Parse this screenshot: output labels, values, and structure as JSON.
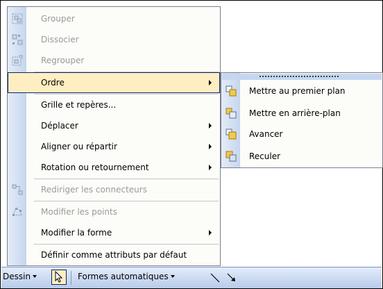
{
  "menu": {
    "items": [
      {
        "label": "Grouper",
        "disabled": true,
        "icon": "group-icon"
      },
      {
        "label": "Dissocier",
        "disabled": true,
        "icon": "ungroup-icon"
      },
      {
        "label": "Regrouper",
        "disabled": true,
        "icon": "regroup-icon"
      },
      {
        "label": "Ordre",
        "submenu": true,
        "highlighted": true
      },
      {
        "label": "Grille et repères...",
        "disabled": false
      },
      {
        "label": "Déplacer",
        "submenu": true
      },
      {
        "label": "Aligner ou répartir",
        "submenu": true
      },
      {
        "label": "Rotation ou retournement",
        "submenu": true
      },
      {
        "label": "Rediriger les connecteurs",
        "disabled": true,
        "icon": "reroute-connectors-icon"
      },
      {
        "label": "Modifier les points",
        "disabled": true,
        "icon": "edit-points-icon"
      },
      {
        "label": "Modifier la forme",
        "submenu": true
      },
      {
        "label": "Définir comme attributs par défaut",
        "disabled": false
      }
    ]
  },
  "submenu": {
    "items": [
      {
        "label": "Mettre au premier plan",
        "icon": "bring-to-front-icon"
      },
      {
        "label": "Mettre en arrière-plan",
        "icon": "send-to-back-icon"
      },
      {
        "label": "Avancer",
        "icon": "bring-forward-icon"
      },
      {
        "label": "Reculer",
        "icon": "send-backward-icon"
      }
    ]
  },
  "toolbar": {
    "draw_label": "Dessin",
    "autoshapes_label": "Formes automatiques"
  },
  "colors": {
    "highlight": "#ffeec2",
    "highlight_border": "#0a246a",
    "gutter": "#c6d6ee",
    "disabled_text": "#9a9a9a"
  }
}
